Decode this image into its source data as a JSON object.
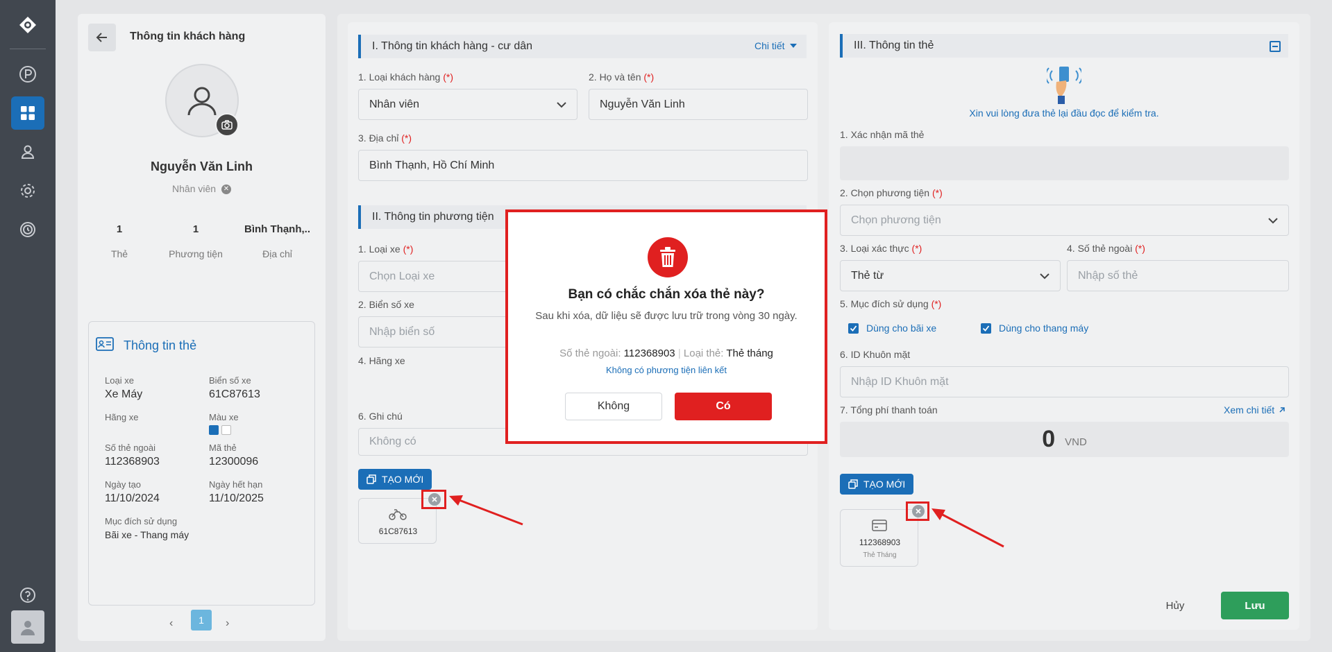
{
  "sidebar": {
    "icons": [
      "logo-icon",
      "parking-icon",
      "dashboard-icon",
      "user-icon",
      "settings-icon",
      "history-icon",
      "help-icon",
      "avatar"
    ]
  },
  "customer": {
    "header_title": "Thông tin khách hàng",
    "name": "Nguyễn Văn Linh",
    "role": "Nhân viên",
    "stats": [
      {
        "value": "1",
        "label": "Thẻ"
      },
      {
        "value": "1",
        "label": "Phương tiện"
      },
      {
        "value": "Bình Thạnh,..",
        "label": "Địa chỉ"
      }
    ]
  },
  "card_info": {
    "title": "Thông tin thẻ",
    "fields": {
      "vehicle_type_label": "Loại xe",
      "vehicle_type": "Xe Máy",
      "plate_label": "Biển số xe",
      "plate": "61C87613",
      "brand_label": "Hãng xe",
      "color_label": "Màu xe",
      "ext_no_label": "Số thẻ ngoài",
      "ext_no": "112368903",
      "card_code_label": "Mã thẻ",
      "card_code": "12300096",
      "created_label": "Ngày tạo",
      "created": "11/10/2024",
      "expiry_label": "Ngày hết hạn",
      "expiry": "11/10/2025",
      "purpose_label": "Mục đích sử dụng",
      "purpose": "Bãi xe - Thang máy"
    },
    "color_swatches": [
      "#1b6eb7",
      "#ffffff"
    ],
    "page": "1"
  },
  "section1": {
    "title": "I. Thông tin khách hàng - cư dân",
    "detail_link": "Chi tiết",
    "customer_type_label": "1. Loại khách hàng",
    "customer_type": "Nhân viên",
    "fullname_label": "2. Họ và tên",
    "fullname": "Nguyễn Văn Linh",
    "address_label": "3. Địa chỉ",
    "address": "Bình Thạnh, Hồ Chí Minh"
  },
  "section2": {
    "title": "II. Thông tin phương tiện",
    "vehicle_type_label": "1. Loại xe",
    "vehicle_type_ph": "Chọn Loại xe",
    "plate_label": "2. Biển số xe",
    "plate_ph": "Nhập biển số",
    "brand_label": "4. Hãng xe",
    "note_label": "6. Ghi chú",
    "note_ph": "Không có",
    "create_btn": "TẠO MỚI",
    "vehicle_item": "61C87613"
  },
  "section3": {
    "title": "III. Thông tin thẻ",
    "reader_hint": "Xin vui lòng đưa thẻ lại đầu đọc để kiểm tra.",
    "confirm_code_label": "1. Xác nhận mã thẻ",
    "vehicle_label": "2. Chọn phương tiện",
    "vehicle_ph": "Chọn phương tiện",
    "auth_type_label": "3. Loại xác thực",
    "auth_type": "Thẻ từ",
    "ext_no_label": "4. Số thẻ ngoài",
    "ext_no_ph": "Nhập số thẻ",
    "purpose_label": "5. Mục đích sử dụng",
    "purpose_parking": "Dùng cho bãi xe",
    "purpose_elevator": "Dùng cho thang máy",
    "face_id_label": "6. ID Khuôn mặt",
    "face_id_ph": "Nhập ID Khuôn mặt",
    "total_label": "7. Tổng phí thanh toán",
    "view_detail": "Xem chi tiết",
    "total_value": "0",
    "currency": "VND",
    "create_btn": "TẠO MỚI",
    "card_item_no": "112368903",
    "card_item_type": "Thẻ Tháng",
    "cancel_btn": "Hủy",
    "save_btn": "Lưu"
  },
  "required_mark": "(*)",
  "modal": {
    "title": "Bạn có chắc chắn xóa thẻ này?",
    "subtitle": "Sau khi xóa, dữ liệu sẽ được lưu trữ trong vòng 30 ngày.",
    "ext_no_label": "Số thẻ ngoài:",
    "ext_no": "112368903",
    "sep": "|",
    "card_type_label": "Loại thẻ:",
    "card_type": "Thẻ tháng",
    "no_vehicle": "Không có phương tiện liên kết",
    "no_btn": "Không",
    "yes_btn": "Có"
  },
  "colors": {
    "primary": "#1b6eb7",
    "danger": "#e02020",
    "success": "#2e9e5b",
    "sidebar": "#41474f"
  }
}
